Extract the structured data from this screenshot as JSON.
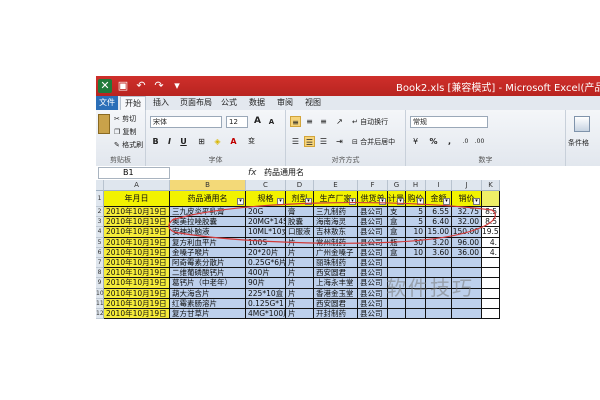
{
  "window": {
    "title": "Book2.xls  [兼容模式] - Microsoft Excel(产品"
  },
  "tabs": [
    "文件",
    "开始",
    "插入",
    "页面布局",
    "公式",
    "数据",
    "审阅",
    "视图"
  ],
  "ribbon": {
    "clipboard": {
      "cut": "剪切",
      "copy": "复制",
      "format_painter": "格式刷",
      "label": "剪贴板"
    },
    "font": {
      "family": "宋体",
      "size": "12",
      "grow": "A",
      "shrink": "A",
      "bold": "B",
      "italic": "I",
      "underline": "U",
      "wen": "变",
      "label": "字体"
    },
    "alignment": {
      "wrap": "自动换行",
      "merge": "合并后居中",
      "label": "对齐方式"
    },
    "number": {
      "format": "常规",
      "percent": "%",
      "comma": ",",
      "label": "数字"
    },
    "styles": {
      "cond": "条件格"
    }
  },
  "formula_bar": {
    "name_box": "B1",
    "fx": "fx",
    "content": "药品通用名"
  },
  "columns": [
    "A",
    "B",
    "C",
    "D",
    "E",
    "F",
    "G",
    "H",
    "I",
    "J",
    "K"
  ],
  "header_row": [
    "年月日",
    "药品通用名",
    "规格",
    "剂型",
    "生产厂家",
    "供货单",
    "计量单位",
    "购价",
    "金额",
    "销价"
  ],
  "rows": [
    [
      "2010年10月19日",
      "三九皮炎平乳膏",
      "20G",
      "膏",
      "三九制药",
      "县公司",
      "支",
      "5",
      "6.55",
      "32.75",
      "8.5"
    ],
    [
      "2010年10月19日",
      "奥美拉唑胶囊",
      "20MG*14S",
      "胶囊",
      "海南海灵",
      "县公司",
      "盒",
      "5",
      "6.40",
      "32.00",
      "8.5"
    ],
    [
      "2010年10月19日",
      "安神补脑液",
      "10ML*10支",
      "口服液",
      "吉林敖东",
      "县公司",
      "盒",
      "10",
      "15.00",
      "150.00",
      "19.5"
    ],
    [
      "2010年10月19日",
      "复方利血平片",
      "100S",
      "片",
      "常州制药",
      "县公司",
      "瓶",
      "30",
      "3.20",
      "96.00",
      "4."
    ],
    [
      "2010年10月19日",
      "金嗓子喉片",
      "20*20片",
      "片",
      "广州金嗓子",
      "县公司",
      "盒",
      "10",
      "3.60",
      "36.00",
      "4."
    ],
    [
      "2010年10月19日",
      "阿奇霉素分散片",
      "0.25G*6片",
      "片",
      "丽珠制药",
      "县公司",
      "",
      "",
      "",
      "",
      ""
    ],
    [
      "2010年10月19日",
      "二维葡磷酸钙片",
      "400片",
      "片",
      "西安圆君",
      "县公司",
      "",
      "",
      "",
      "",
      ""
    ],
    [
      "2010年10月19日",
      "葛钙片（中老年）",
      "90片",
      "片",
      "上海永丰堂",
      "县公司",
      "",
      "",
      "",
      "",
      ""
    ],
    [
      "2010年10月19日",
      "葫大海含片",
      "225*10盒",
      "片",
      "香港金玉堂",
      "县公司",
      "",
      "",
      "",
      "",
      ""
    ],
    [
      "2010年10月19日",
      "红霉素肠溶片",
      "0.125G*1",
      "片",
      "西安圆君",
      "县公司",
      "",
      "",
      "",
      "",
      ""
    ],
    [
      "2010年10月19日",
      "复方甘草片",
      "4MG*100片",
      "片",
      "开封制药",
      "县公司",
      "",
      "",
      "",
      "",
      ""
    ]
  ],
  "watermark": "软件技巧"
}
